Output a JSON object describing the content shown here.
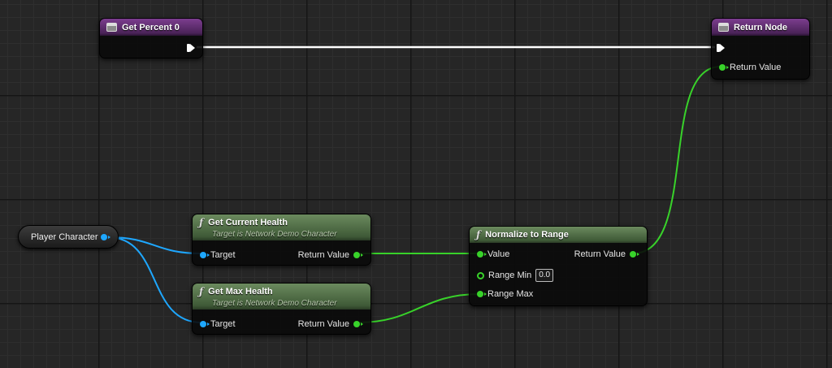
{
  "nodes": {
    "get_percent": {
      "title": "Get Percent 0",
      "icon": "function-entry-icon"
    },
    "return_node": {
      "title": "Return Node",
      "icon": "function-return-icon",
      "pin_return": "Return Value"
    },
    "player_character": {
      "label": "Player Character"
    },
    "get_current_health": {
      "title": "Get Current Health",
      "subtitle": "Target is Network Demo Character",
      "pin_target": "Target",
      "pin_return": "Return Value"
    },
    "get_max_health": {
      "title": "Get Max Health",
      "subtitle": "Target is Network Demo Character",
      "pin_target": "Target",
      "pin_return": "Return Value"
    },
    "normalize_to_range": {
      "title": "Normalize to Range",
      "pin_value": "Value",
      "pin_range_min": "Range Min",
      "range_min_value": "0.0",
      "pin_range_max": "Range Max",
      "pin_return": "Return Value"
    }
  },
  "colors": {
    "exec_wire": "#ffffff",
    "object_pin": "#1ea7ff",
    "float_pin": "#38d22a",
    "event_header": "#7c3d8f",
    "pure_func_header": "#5f7f52"
  },
  "icon_glyphs": {
    "function": "ƒ"
  }
}
